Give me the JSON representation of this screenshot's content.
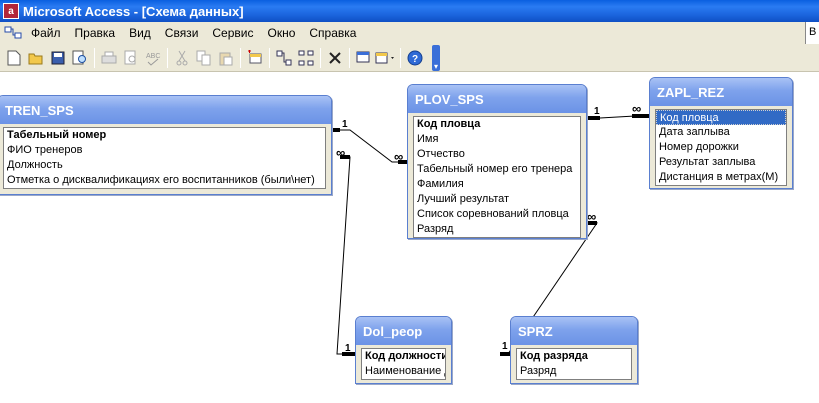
{
  "window": {
    "title": "Microsoft Access - [Схема данных]",
    "app_icon_letter": "a"
  },
  "menu": {
    "items": [
      {
        "id": "file",
        "label": "Файл"
      },
      {
        "id": "edit",
        "label": "Правка"
      },
      {
        "id": "view",
        "label": "Вид"
      },
      {
        "id": "relations",
        "label": "Связи"
      },
      {
        "id": "service",
        "label": "Сервис"
      },
      {
        "id": "window",
        "label": "Окно"
      },
      {
        "id": "help",
        "label": "Справка"
      }
    ],
    "right_edge_text": "В"
  },
  "toolbar": {
    "buttons": [
      "new-icon",
      "open-icon",
      "save-icon",
      "file-search-icon",
      "print-icon",
      "print-preview-icon",
      "spelling-icon",
      "cut-icon",
      "copy-icon",
      "paste-icon",
      "show-table-icon",
      "show-direct-icon",
      "show-all-icon",
      "delete-icon",
      "new-object-icon",
      "help-icon"
    ]
  },
  "tables": [
    {
      "id": "tren_sps",
      "title": "TREN_SPS",
      "fields": [
        {
          "label": "Табельный номер",
          "key": true
        },
        {
          "label": "ФИО тренеров"
        },
        {
          "label": "Должность"
        },
        {
          "label": "Отметка о дисквалификациях его воспитанников (были\\нет)"
        }
      ]
    },
    {
      "id": "plov_sps",
      "title": "PLOV_SPS",
      "fields": [
        {
          "label": "Код пловца",
          "key": true
        },
        {
          "label": "Имя"
        },
        {
          "label": "Отчество"
        },
        {
          "label": "Табельный номер его тренера"
        },
        {
          "label": "Фамилия"
        },
        {
          "label": "Лучший результат"
        },
        {
          "label": "Список соревнований пловца"
        },
        {
          "label": "Разряд"
        }
      ]
    },
    {
      "id": "zapl_rez",
      "title": "ZAPL_REZ",
      "fields": [
        {
          "label": "Код пловца",
          "selected": true
        },
        {
          "label": "Дата заплыва"
        },
        {
          "label": "Номер дорожки"
        },
        {
          "label": "Результат заплыва"
        },
        {
          "label": "Дистанция в метрах(М)"
        }
      ]
    },
    {
      "id": "dol_peop",
      "title": "Dol_peop",
      "fields": [
        {
          "label": "Код должности",
          "key": true
        },
        {
          "label": "Наименование д"
        }
      ]
    },
    {
      "id": "sprz",
      "title": "SPRZ",
      "fields": [
        {
          "label": "Код разряда",
          "key": true
        },
        {
          "label": "Разряд"
        }
      ]
    }
  ],
  "relationships": [
    {
      "from": "TREN_SPS",
      "to": "PLOV_SPS",
      "one_label": "1",
      "many_label": "∞"
    },
    {
      "from": "PLOV_SPS",
      "to": "ZAPL_REZ",
      "one_label": "1",
      "many_label": "∞"
    },
    {
      "from": "Dol_peop",
      "to": "TREN_SPS",
      "one_label": "1",
      "many_label": "∞"
    },
    {
      "from": "SPRZ",
      "to": "PLOV_SPS",
      "one_label": "1",
      "many_label": "∞"
    }
  ]
}
